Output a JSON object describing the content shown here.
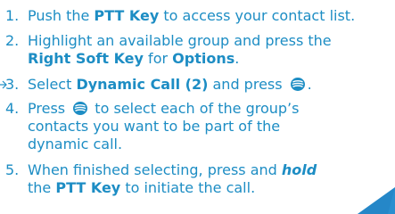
{
  "steps": [
    {
      "number": "1.",
      "pre": "Push the ",
      "key": "PTT Key",
      "post": " to access your contact list."
    },
    {
      "number": "2.",
      "line1": "Highlight an available group and press the",
      "key": "Right Soft Key",
      "mid": " for ",
      "key2": "Options",
      "post": "."
    },
    {
      "number": "3.",
      "pre": "Select ",
      "key": "Dynamic Call (2)",
      "mid": " and press ",
      "post": "."
    },
    {
      "number": "4.",
      "pre": "Press ",
      "line1_rest": " to select each of the group’s",
      "line2": "contacts you want to be part of the",
      "line3": "dynamic call."
    },
    {
      "number": "5.",
      "pre": "When finished selecting, press and ",
      "emph": "hold",
      "line2_pre": "the ",
      "key": "PTT Key",
      "post": " to initiate the call."
    }
  ],
  "icons": {
    "ok_key": "ok-key-icon",
    "arrow": "left-arrow-marker",
    "corner": "corner-tab-decoration"
  },
  "colors": {
    "text": "#1d8dc4",
    "icon": "#1d8dc4",
    "corner": "#2a8fd0"
  }
}
